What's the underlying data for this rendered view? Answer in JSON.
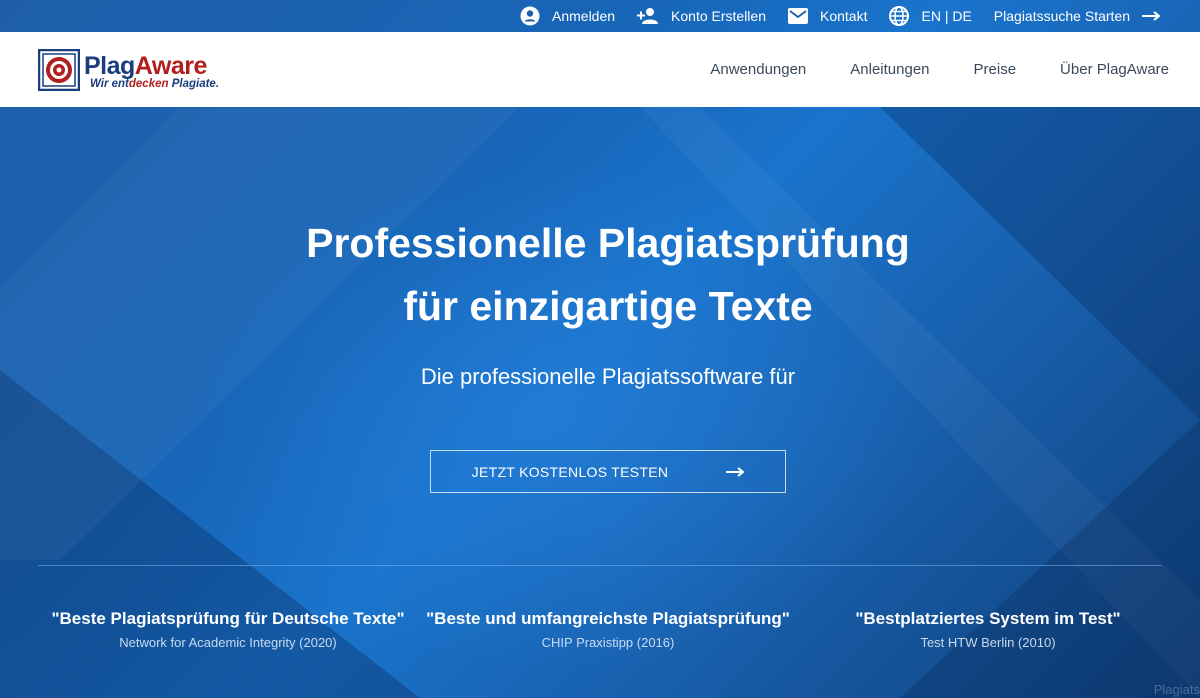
{
  "topbar": {
    "login": "Anmelden",
    "register": "Konto Erstellen",
    "contact": "Kontakt",
    "language": "EN | DE",
    "start_search": "Plagiatssuche Starten"
  },
  "logo": {
    "name_part1": "Plag",
    "name_part2": "Aware",
    "tagline_part1": "Wir ent",
    "tagline_part2": "decken",
    "tagline_part3": " Plagiate."
  },
  "nav": {
    "items": [
      "Anwendungen",
      "Anleitungen",
      "Preise",
      "Über PlagAware"
    ]
  },
  "hero": {
    "title_line1": "Professionelle Plagiatsprüfung",
    "title_line2": "für einzigartige Texte",
    "subtitle": "Die professionelle Plagiatssoftware für",
    "cta": "JETZT KOSTENLOS TESTEN"
  },
  "quotes": [
    {
      "title": "\"Beste Plagiatsprüfung für Deutsche Texte\"",
      "source": "Network for Academic Integrity (2020)"
    },
    {
      "title": "\"Beste und umfangreichste Plagiatsprüfung\"",
      "source": "CHIP Praxistipp (2016)"
    },
    {
      "title": "\"Bestplatziertes System im Test\"",
      "source": "Test HTW Berlin (2010)"
    }
  ],
  "corner_text": "Plagiats",
  "colors": {
    "brand_blue": "#1a3d7c",
    "brand_red": "#b01e1e",
    "hero_blue": "#1766b8"
  }
}
